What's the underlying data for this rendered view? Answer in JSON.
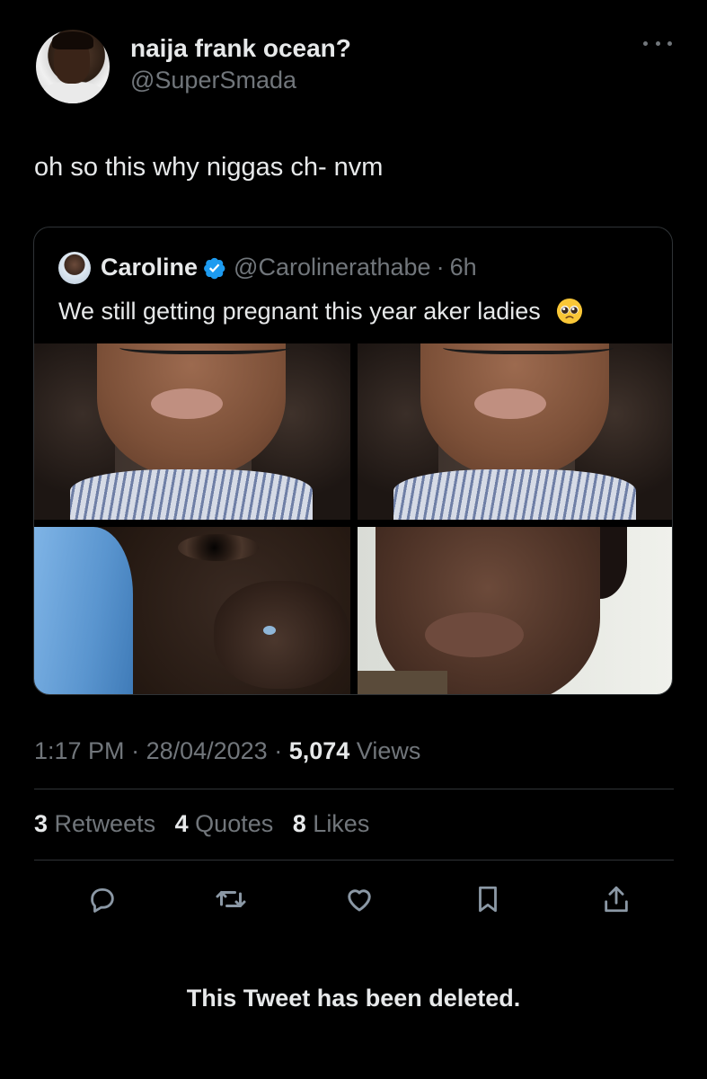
{
  "tweet": {
    "display_name": "naija frank ocean?",
    "handle": "@SuperSmada",
    "text": "oh so this why niggas ch- nvm",
    "time": "1:17 PM",
    "date": "28/04/2023",
    "views_count": "5,074",
    "views_label": "Views",
    "separator": " · "
  },
  "quote": {
    "name": "Caroline",
    "handle": "@Carolinerathabe",
    "dot": "·",
    "time": "6h",
    "text": "We still getting pregnant this year aker ladies",
    "emoji": "pleading-face-icon"
  },
  "stats": {
    "retweets_count": "3",
    "retweets_label": "Retweets",
    "quotes_count": "4",
    "quotes_label": "Quotes",
    "likes_count": "8",
    "likes_label": "Likes"
  },
  "actions": [
    "reply-icon",
    "retweet-icon",
    "like-icon",
    "bookmark-icon",
    "share-icon"
  ],
  "notice": "This Tweet has been deleted.",
  "colors": {
    "background": "#000000",
    "primary_text": "#e7e9ea",
    "secondary_text": "#71767b",
    "border": "#2f3336",
    "verified": "#1d9bf0"
  }
}
